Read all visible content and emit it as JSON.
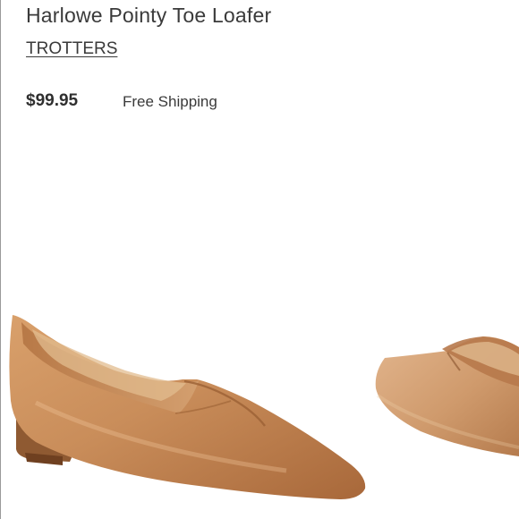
{
  "product": {
    "title": "Harlowe Pointy Toe Loafer",
    "brand": "TROTTERS",
    "price": "$99.95",
    "shipping": "Free Shipping"
  },
  "image": {
    "subject": "tan-leather-pointy-toe-loafers",
    "main_color": "#c98d5a",
    "shadow_color": "#8f5a32"
  }
}
